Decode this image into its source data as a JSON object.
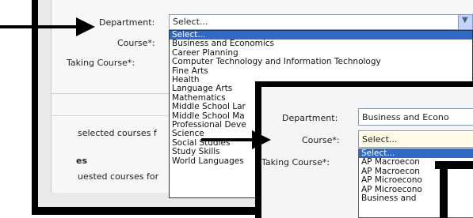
{
  "back_form": {
    "department_label": "Department:",
    "department_value": "Select...",
    "course_label": "Course*:",
    "taking_label": "Taking Course*:",
    "selected_courses_text": "selected courses f",
    "es_text": "es",
    "requested_courses_text": "uested courses for"
  },
  "department_options": [
    "Select...",
    "Business and Economics",
    "Career Planning",
    "Computer Technology and Information Technology",
    "Fine Arts",
    "Health",
    "Language Arts",
    "Mathematics",
    "Middle School Lar",
    "Middle School Ma",
    "Professional Deve",
    "Science",
    "Social Studies",
    "Study Skills",
    "World Languages"
  ],
  "front_form": {
    "department_label": "Department:",
    "department_value": "Business and Econo",
    "course_label": "Course*:",
    "course_value": "Select...",
    "taking_label": "Taking Course*:"
  },
  "course_options": [
    "Select...",
    "AP Macroecon",
    "AP Macroecon",
    "AP Microecono",
    "AP Microecono",
    "Business and"
  ],
  "colors": {
    "highlight": "#316ac5",
    "border": "#7f9db9",
    "course_field_bg": "#fffbe6"
  }
}
